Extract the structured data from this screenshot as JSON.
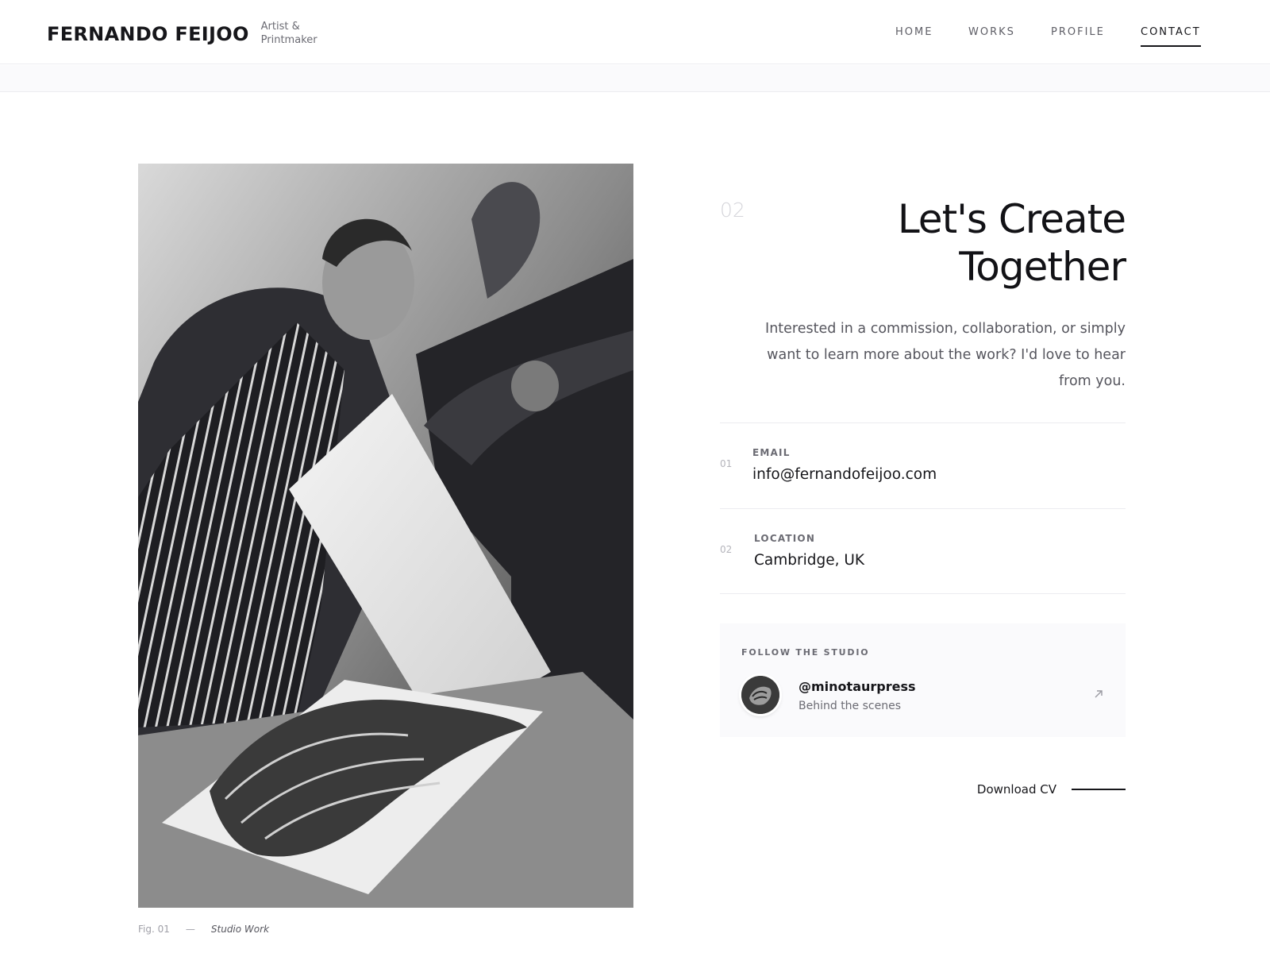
{
  "header": {
    "brand_name": "FERNANDO FEIJOO",
    "brand_tagline": "Artist & Printmaker",
    "nav": [
      {
        "label": "HOME"
      },
      {
        "label": "WORKS"
      },
      {
        "label": "PROFILE"
      },
      {
        "label": "CONTACT",
        "active": true
      }
    ]
  },
  "figure": {
    "subject": "black and white photo of the artist lifting a print from a press",
    "caption_number": "Fig. 01",
    "caption_separator": "—",
    "caption_title": "Studio Work"
  },
  "contact": {
    "section_number": "02",
    "headline_line1": "Let's Create",
    "headline_line2": "Together",
    "intro": "Interested in a commission, collaboration, or simply want to learn more about the work? I'd love to hear from you.",
    "rows": [
      {
        "number": "01",
        "label": "EMAIL",
        "value": "info@fernandofeijoo.com"
      },
      {
        "number": "02",
        "label": "LOCATION",
        "value": "Cambridge, UK"
      }
    ],
    "follow": {
      "title": "FOLLOW THE STUDIO",
      "handle": "@minotaurpress",
      "subtitle": "Behind the scenes",
      "icon": "arrow-up-right-icon"
    },
    "download_label": "Download CV"
  },
  "colors": {
    "text": "#16161a",
    "muted": "#6b6b73",
    "rule": "#ececf0",
    "card_bg": "#fafafc"
  }
}
